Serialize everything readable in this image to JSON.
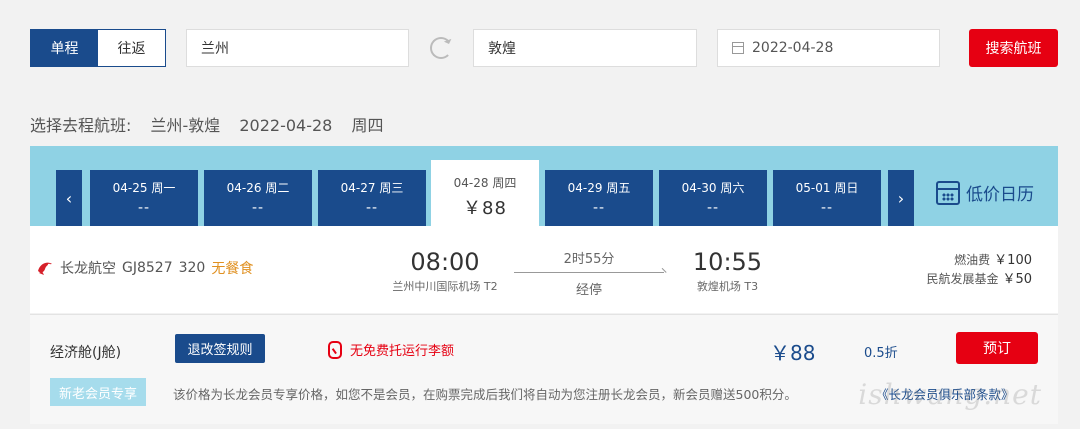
{
  "search": {
    "trip_types": [
      "单程",
      "往返"
    ],
    "from_value": "兰州",
    "to_value": "敦煌",
    "date_value": "2022-04-28",
    "search_label": "搜索航班"
  },
  "route_header": {
    "prefix": "选择去程航班:",
    "route": "兰州-敦煌",
    "date": "2022-04-28",
    "weekday": "周四"
  },
  "date_tabs": [
    {
      "date": "04-25 周一",
      "price": "--"
    },
    {
      "date": "04-26 周二",
      "price": "--"
    },
    {
      "date": "04-27 周三",
      "price": "--"
    },
    {
      "date": "04-28 周四",
      "price": "￥88",
      "active": true
    },
    {
      "date": "04-29 周五",
      "price": "--"
    },
    {
      "date": "04-30 周六",
      "price": "--"
    },
    {
      "date": "05-01 周日",
      "price": "--"
    }
  ],
  "nav": {
    "prev": "‹",
    "next": "›"
  },
  "low_price_calendar": "低价日历",
  "flight": {
    "airline": "长龙航空",
    "flight_no": "GJ8527",
    "aircraft": "320",
    "meal": "无餐食",
    "dep_time": "08:00",
    "dep_airport": "兰州中川国际机场 T2",
    "duration": "2时55分",
    "stop": "经停",
    "arr_time": "10:55",
    "arr_airport": "敦煌机场 T3",
    "fuel_label": "燃油费",
    "fuel_value": "￥100",
    "fund_label": "民航发展基金",
    "fund_value": "￥50"
  },
  "cabin": {
    "name": "经济舱(J舱)",
    "rules_label": "退改签规则",
    "baggage": "无免费托运行李额",
    "price": "￥88",
    "discount": "0.5折",
    "book_label": "预订",
    "member_badge": "新老会员专享",
    "member_note": "该价格为长龙会员专享价格，如您不是会员，在购票完成后我们将自动为您注册长龙会员，新会员赠送500积分。",
    "member_link": "《长龙会员俱乐部条款》"
  },
  "watermark": "ishwang.net",
  "colors": {
    "brand_blue": "#1a4b8c",
    "accent_red": "#e60012",
    "strip_cyan": "#8fd2e4"
  }
}
